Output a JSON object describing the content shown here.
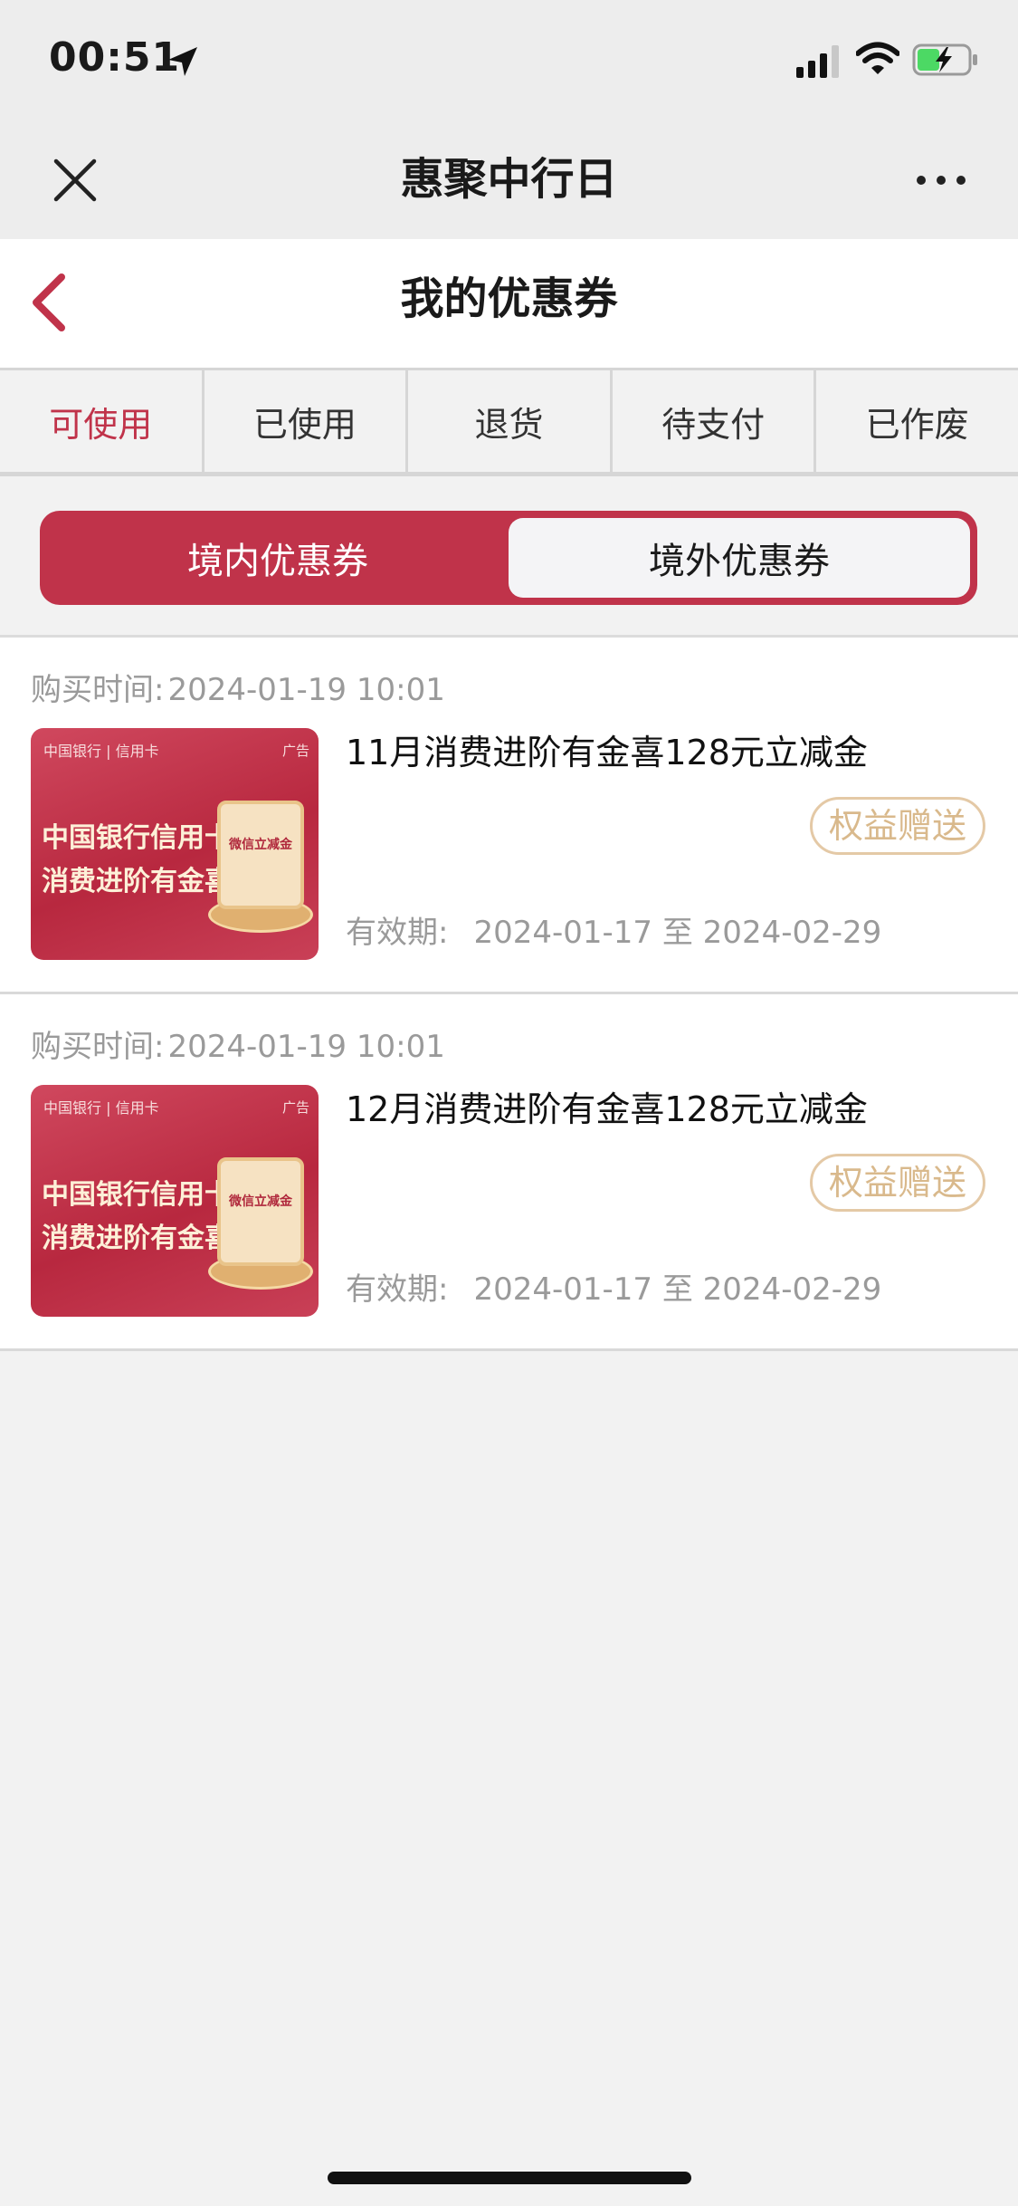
{
  "status_bar": {
    "time": "00:51"
  },
  "wechat_nav": {
    "title": "惠聚中行日"
  },
  "page": {
    "title": "我的优惠券"
  },
  "tabs": [
    "可使用",
    "已使用",
    "退货",
    "待支付",
    "已作废"
  ],
  "segments": [
    "境内优惠券",
    "境外优惠券"
  ],
  "coupons": [
    {
      "purchase_label": "购买时间:",
      "purchase_time": "2024-01-19 10:01",
      "name": "11月消费进阶有金喜128元立减金",
      "badge": "权益赠送",
      "validity_label": "有效期:",
      "validity": "2024-01-17 至 2024-02-29",
      "thumb": {
        "logo": "中国银行 | 信用卡",
        "ad": "广告",
        "line1": "中国银行信用卡",
        "line2": "消费进阶有金喜",
        "card_text": "微信立减金"
      }
    },
    {
      "purchase_label": "购买时间:",
      "purchase_time": "2024-01-19 10:01",
      "name": "12月消费进阶有金喜128元立减金",
      "badge": "权益赠送",
      "validity_label": "有效期:",
      "validity": "2024-01-17 至 2024-02-29",
      "thumb": {
        "logo": "中国银行 | 信用卡",
        "ad": "广告",
        "line1": "中国银行信用卡",
        "line2": "消费进阶有金喜",
        "card_text": "微信立减金"
      }
    }
  ],
  "colors": {
    "accent": "#c0334a",
    "badge": "#d9b98c",
    "muted": "#9a9a9a",
    "background": "#f2f2f2"
  },
  "icons": {
    "status": [
      "location-arrow-icon",
      "signal-icon",
      "wifi-icon",
      "battery-charging-icon"
    ],
    "nav": [
      "close-icon",
      "more-icon",
      "back-icon"
    ]
  }
}
